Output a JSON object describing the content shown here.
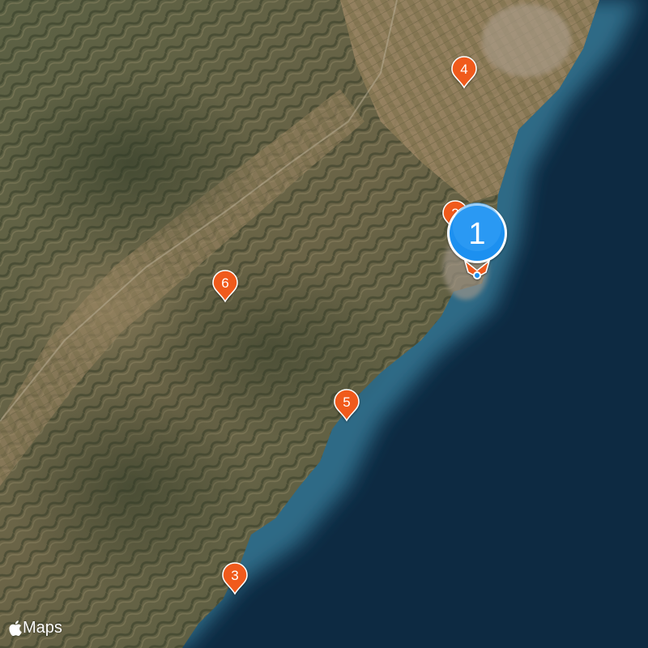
{
  "map": {
    "style": "satellite",
    "colors": {
      "sea_deep": "#0d2a42",
      "sea_shallow": "#2f6a86",
      "land_dark": "#4d5a3e",
      "land_light": "#8f7d5c",
      "pin_orange": "#f05a1c",
      "pin_blue": "#1e90f0"
    },
    "markers": [
      {
        "label": "1",
        "kind": "selected",
        "color": "#1e90f0"
      },
      {
        "label": "2",
        "kind": "cluster",
        "color": "#f05a1c"
      },
      {
        "label": "3",
        "kind": "cluster",
        "color": "#f05a1c"
      },
      {
        "label": "4",
        "kind": "cluster",
        "color": "#f05a1c"
      },
      {
        "label": "5",
        "kind": "cluster",
        "color": "#f05a1c"
      },
      {
        "label": "6",
        "kind": "cluster",
        "color": "#f05a1c"
      }
    ]
  },
  "attribution": {
    "icon": "apple-logo-icon",
    "text": "Maps"
  }
}
